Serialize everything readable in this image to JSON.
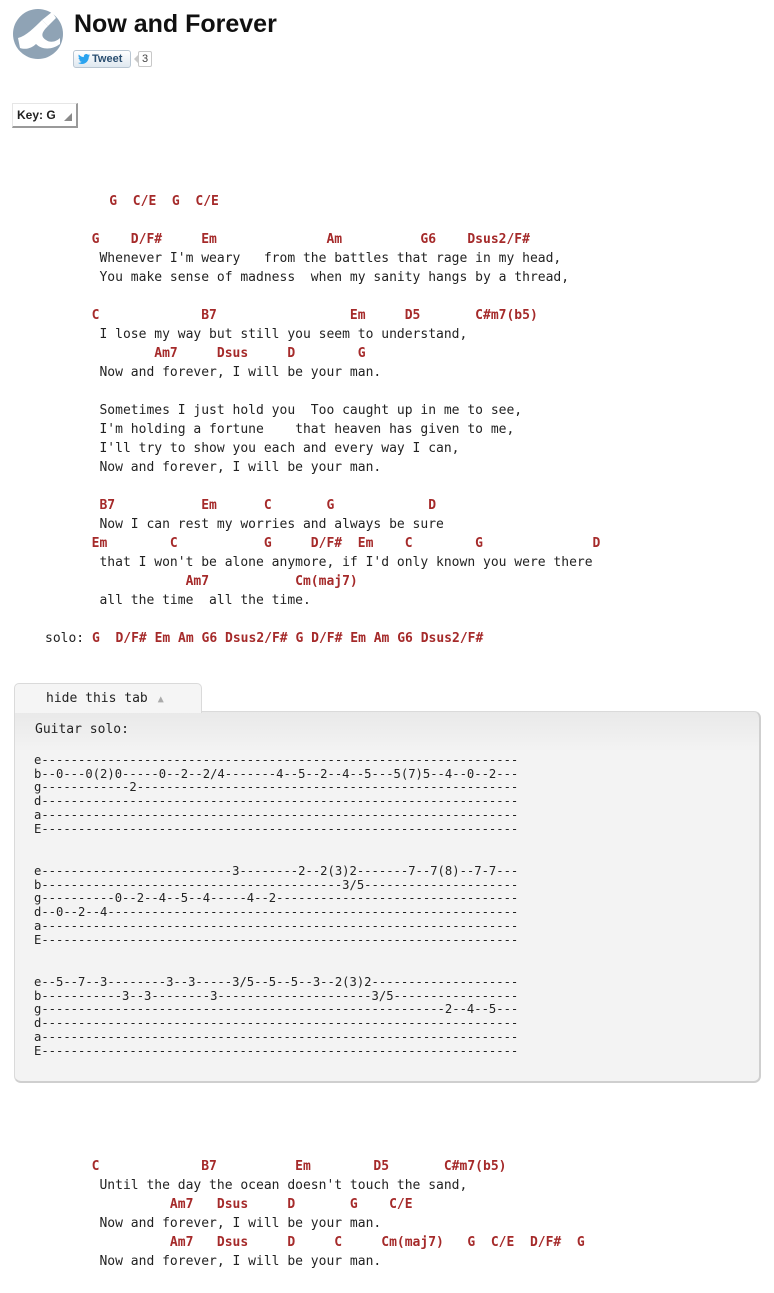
{
  "title": "Now and Forever",
  "tweet": {
    "label": "Tweet",
    "count": "3"
  },
  "key": {
    "label": "Key:",
    "value": "G"
  },
  "intro_chords": "    G  C/E  G  C/E",
  "verses": [
    {
      "chords": "  G    D/F#     Em              Am          G6    Dsus2/F#",
      "lyric": "   Whenever I'm weary   from the battles that rage in my head,"
    },
    {
      "chords": "",
      "lyric": "   You make sense of madness  when my sanity hangs by a thread,"
    },
    {
      "chords": "",
      "lyric": ""
    },
    {
      "chords": "  C             B7                 Em     D5       C#m7(b5)",
      "lyric": "   I lose my way but still you seem to understand,"
    },
    {
      "chords": "          Am7     Dsus     D        G",
      "lyric": "   Now and forever, I will be your man."
    },
    {
      "chords": "",
      "lyric": ""
    },
    {
      "chords": "",
      "lyric": "   Sometimes I just hold you  Too caught up in me to see,"
    },
    {
      "chords": "",
      "lyric": "   I'm holding a fortune    that heaven has given to me,"
    },
    {
      "chords": "",
      "lyric": "   I'll try to show you each and every way I can,"
    },
    {
      "chords": "",
      "lyric": "   Now and forever, I will be your man."
    },
    {
      "chords": "",
      "lyric": ""
    },
    {
      "chords": "   B7           Em      C       G            D",
      "lyric": "   Now I can rest my worries and always be sure"
    },
    {
      "chords": "  Em        C           G     D/F#  Em    C        G              D",
      "lyric": "   that I won't be alone anymore, if I'd only known you were there"
    },
    {
      "chords": "              Am7           Cm(maj7)",
      "lyric": "   all the time  all the time."
    }
  ],
  "solo": {
    "label": "solo:",
    "chords": "G  D/F# Em Am G6 Dsus2/F# G D/F# Em Am G6 Dsus2/F#"
  },
  "tab": {
    "toggle_label": "hide this tab",
    "title": "Guitar solo:",
    "blocks": [
      "e-----------------------------------------------------------------\nb--0---0(2)0-----0--2--2/4-------4--5--2--4--5---5(7)5--4--0--2---\ng------------2----------------------------------------------------\nd-----------------------------------------------------------------\na-----------------------------------------------------------------\nE-----------------------------------------------------------------",
      "e--------------------------3--------2--2(3)2-------7--7(8)--7-7---\nb-----------------------------------------3/5---------------------\ng----------0--2--4--5--4-----4--2---------------------------------\nd--0--2--4--------------------------------------------------------\na-----------------------------------------------------------------\nE-----------------------------------------------------------------",
      "e--5--7--3--------3--3-----3/5--5--5--3--2(3)2--------------------\nb-----------3--3--------3---------------------3/5-----------------\ng-------------------------------------------------------2--4--5---\nd-----------------------------------------------------------------\na-----------------------------------------------------------------\nE-----------------------------------------------------------------"
    ]
  },
  "outro": [
    {
      "chords": "  C             B7          Em        D5       C#m7(b5)",
      "lyric": "   Until the day the ocean doesn't touch the sand,"
    },
    {
      "chords": "            Am7   Dsus     D       G    C/E",
      "lyric": "   Now and forever, I will be your man."
    },
    {
      "chords": "            Am7   Dsus     D     C     Cm(maj7)   G  C/E  D/F#  G",
      "lyric": "   Now and forever, I will be your man."
    }
  ]
}
